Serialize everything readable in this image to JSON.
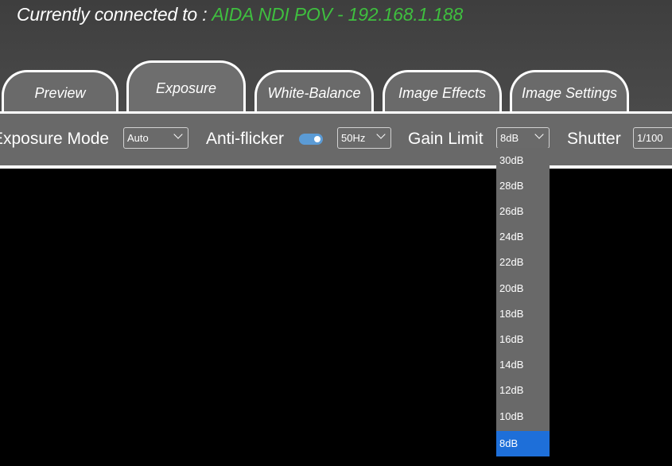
{
  "header": {
    "connected_label": "Currently connected to :",
    "device": "AIDA NDI POV - 192.168.1.188",
    "device_color": "#3fbf3f"
  },
  "tabs": [
    {
      "label": "Preview",
      "active": false
    },
    {
      "label": "Exposure",
      "active": true
    },
    {
      "label": "White-Balance",
      "active": false
    },
    {
      "label": "Image Effects",
      "active": false
    },
    {
      "label": "Image Settings",
      "active": false
    }
  ],
  "toolbar": {
    "exposure_mode_label": "Exposure Mode",
    "exposure_mode_value": "Auto",
    "anti_flicker_label": "Anti-flicker",
    "anti_flicker_on": true,
    "anti_flicker_value": "50Hz",
    "gain_limit_label": "Gain Limit",
    "gain_limit_value": "8dB",
    "shutter_label": "Shutter",
    "shutter_value": "1/100"
  },
  "gain_limit_options": [
    "30dB",
    "28dB",
    "26dB",
    "24dB",
    "22dB",
    "20dB",
    "18dB",
    "16dB",
    "14dB",
    "12dB",
    "10dB",
    "8dB"
  ],
  "gain_limit_selected": "8dB",
  "colors": {
    "accent": "#5b9bd5",
    "selected_option": "#1e6fd9",
    "panel": "#696969",
    "header": "#444444"
  }
}
